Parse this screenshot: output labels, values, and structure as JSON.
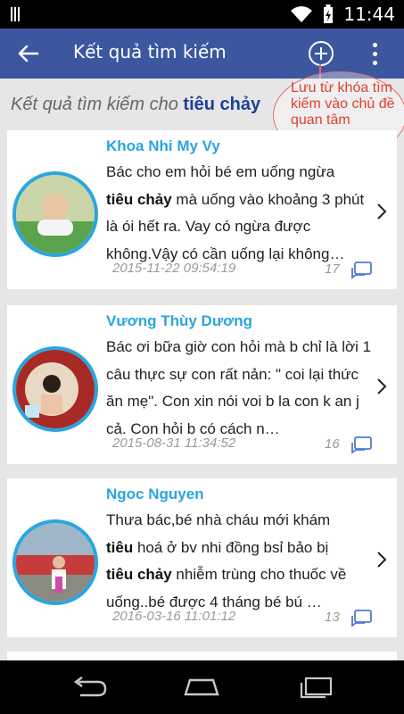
{
  "status_bar": {
    "time": "11:44"
  },
  "app_bar": {
    "title": "Kết quả tìm kiếm"
  },
  "search_caption": {
    "prefix": "Kết quả tìm kiếm cho ",
    "keyword": "tiêu chảy"
  },
  "tooltip": {
    "text": "Lưu từ khóa tìm kiếm vào chủ đề quan tâm"
  },
  "results": [
    {
      "name": "Khoa Nhi My Vy",
      "line1": "Bác cho em hỏi bé em uống ngừa",
      "kw1": "tiêu chảy",
      "rest1": " mà uống vào khoảng 3 phút là ói hết ra. Vay có ngừa được không.Vậy có cần uống lại không…",
      "date": "2015-11-22 09:54:19",
      "count": "17"
    },
    {
      "name": "Vương Thùy Dương",
      "line1": "Bác ơi bữa giờ con hỏi mà b chỉ là lời 1 câu thực sự con rất nản: \" coi lại thức ăn mẹ\". Con xin nói voi b la con k an j cả. Con hỏi b có cách n…",
      "date": "2015-08-31 11:34:52",
      "count": "16"
    },
    {
      "name": "Ngoc Nguyen",
      "line1": "Thưa bác,bé nhà cháu mới khám",
      "kw_a": "tiêu",
      "mid": " hoá ở bv nhi đồng bsỉ bảo bị",
      "kw_b": "tiêu chảy",
      "rest": " nhiễm trùng cho thuốc về uống..bé được 4 tháng bé bú …",
      "date": "2016-03-16 11:01:12",
      "count": "13"
    }
  ],
  "colors": {
    "app_bar": "#3c57a0",
    "name": "#2aa5e0",
    "keyword": "#1f3f9c",
    "annotation": "#e0412e"
  },
  "icons": [
    "back-arrow-icon",
    "add-circle-icon",
    "more-vert-icon",
    "chevron-right-icon",
    "comment-icon",
    "nav-back-icon",
    "nav-home-icon",
    "nav-recents-icon"
  ]
}
